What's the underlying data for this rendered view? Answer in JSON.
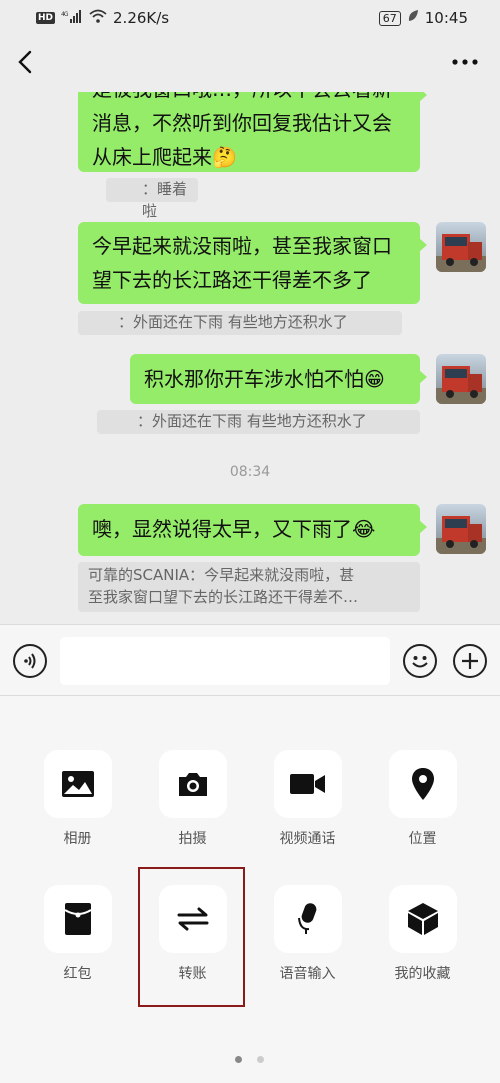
{
  "status_bar": {
    "hd": "HD",
    "network": "46",
    "speed": "2.26K/s",
    "battery": "67",
    "time": "10:45"
  },
  "nav": {
    "back_icon": "chevron-left-icon",
    "more_icon": "more-dots-icon"
  },
  "messages": [
    {
      "type": "sent",
      "text_line1": "是被我窗口哦…，所以不会去看新",
      "text_line2": "消息，不然听到你回复我估计又会",
      "text_line3": "从床上爬起来🤔"
    },
    {
      "type": "quote",
      "text": "：睡着啦"
    },
    {
      "type": "sent",
      "text_line1": "今早起来就没雨啦，甚至我家窗口",
      "text_line2": "望下去的长江路还干得差不多了"
    },
    {
      "type": "quote",
      "text": "：外面还在下雨 有些地方还积水了"
    },
    {
      "type": "sent",
      "text_line1": "积水那你开车涉水怕不怕😁"
    },
    {
      "type": "quote",
      "text": "：外面还在下雨 有些地方还积水了"
    },
    {
      "type": "time",
      "text": "08:34"
    },
    {
      "type": "sent",
      "text_line1": "噢，显然说得太早，又下雨了😂"
    },
    {
      "type": "quote",
      "text_line1": "可靠的SCANIA：今早起来就没雨啦，甚",
      "text_line2": "至我家窗口望下去的长江路还干得差不…"
    }
  ],
  "input": {
    "value": "",
    "voice_icon": "voice-icon",
    "emoji_icon": "emoji-icon",
    "plus_icon": "plus-icon"
  },
  "panel": {
    "tiles": [
      {
        "label": "相册",
        "icon": "photo-album-icon"
      },
      {
        "label": "拍摄",
        "icon": "camera-icon"
      },
      {
        "label": "视频通话",
        "icon": "video-call-icon"
      },
      {
        "label": "位置",
        "icon": "location-icon"
      },
      {
        "label": "红包",
        "icon": "red-packet-icon"
      },
      {
        "label": "转账",
        "icon": "transfer-icon"
      },
      {
        "label": "语音输入",
        "icon": "microphone-icon"
      },
      {
        "label": "我的收藏",
        "icon": "favorites-icon"
      }
    ],
    "page_index": 1,
    "page_count": 2
  }
}
